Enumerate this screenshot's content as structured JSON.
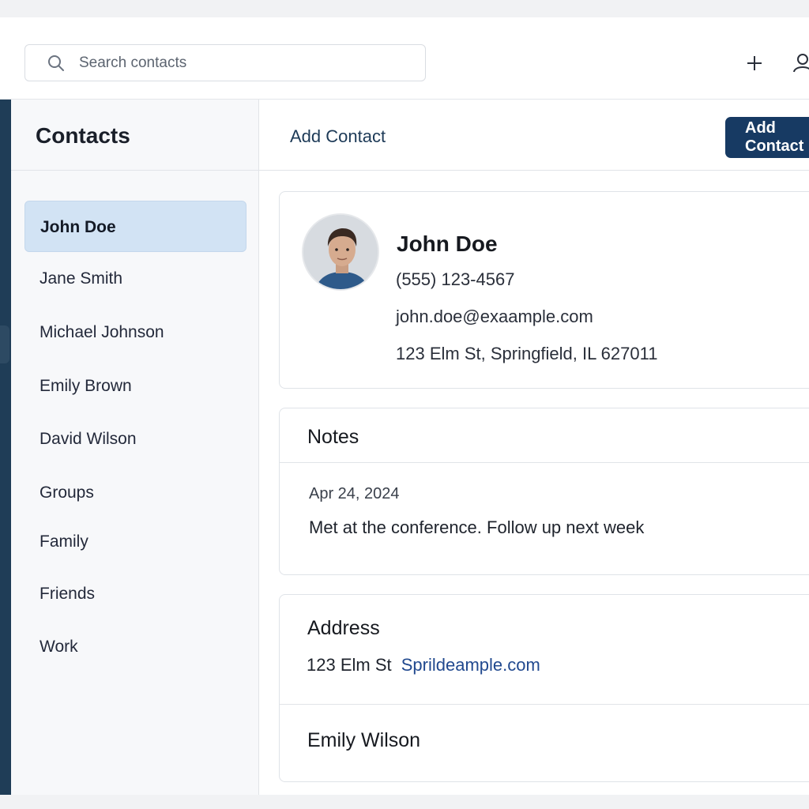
{
  "search": {
    "placeholder": "Search contacts",
    "value": ""
  },
  "topbar": {
    "add_icon": "plus-icon",
    "profile_icon": "user-icon"
  },
  "sidebar": {
    "title": "Contacts",
    "items": [
      {
        "label": "John Doe",
        "active": true
      },
      {
        "label": "Jane Smith"
      },
      {
        "label": "Michael Johnson"
      },
      {
        "label": "Emily Brown"
      },
      {
        "label": "David Wilson"
      },
      {
        "label": "Groups"
      },
      {
        "label": "Family"
      },
      {
        "label": "Friends"
      },
      {
        "label": "Work"
      }
    ]
  },
  "main": {
    "add_contact_link": "Add Contact",
    "add_contact_button": "Add Contact",
    "profile": {
      "name": "John Doe",
      "phone": "(555) 123-4567",
      "email": "john.doe@exaample.com",
      "address": "123 Elm St, Springfield, IL 627011"
    },
    "notes": {
      "title": "Notes",
      "date": "Apr 24, 2024",
      "text": "Met at the conference.  Follow up  next  week"
    },
    "address_card": {
      "title": "Address",
      "street": "123 Elm St",
      "link": "Sprildeample.com",
      "name": "Emily Wilson"
    }
  },
  "colors": {
    "accent": "#173a63",
    "active_item_bg": "#d2e3f4",
    "link": "#21498f",
    "strip": "#1f3d57"
  }
}
